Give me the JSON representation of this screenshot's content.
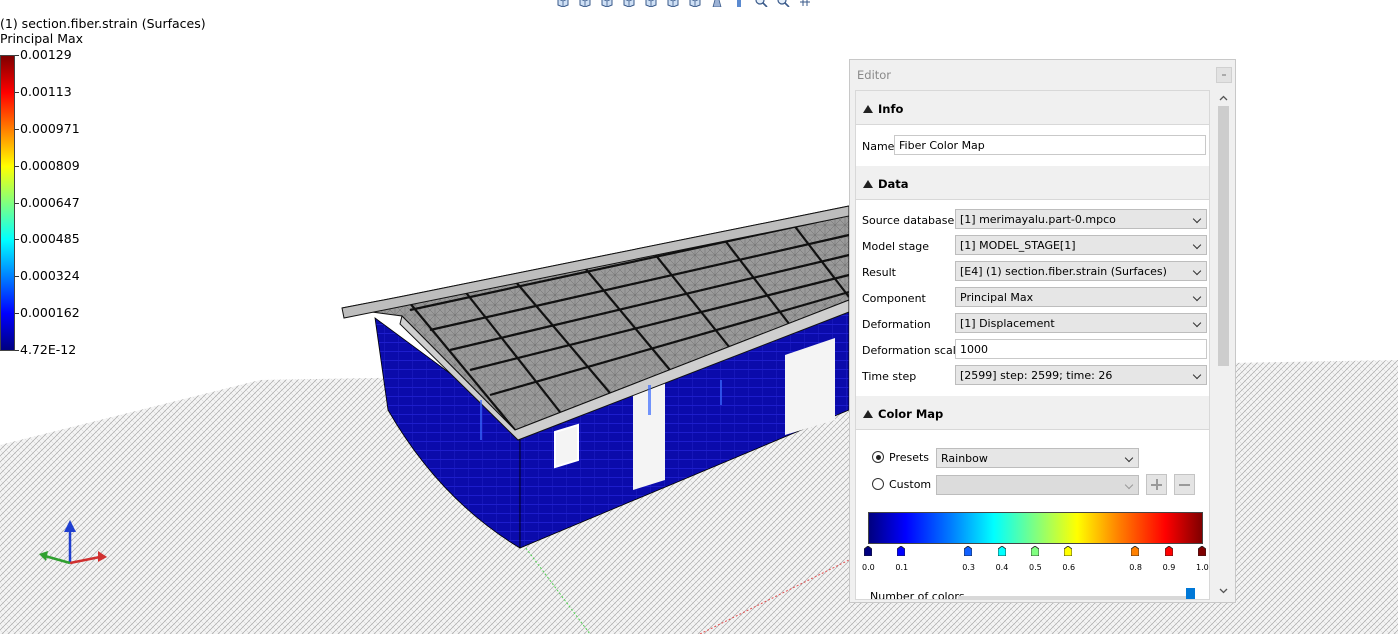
{
  "legend": {
    "title": "(1) section.fiber.strain (Surfaces)",
    "subtitle": "Principal Max",
    "labels": [
      "0.00129",
      "0.00113",
      "0.000971",
      "0.000809",
      "0.000647",
      "0.000485",
      "0.000324",
      "0.000162",
      "4.72E-12"
    ]
  },
  "toolbar": {
    "icons": [
      "view-iso-icon",
      "view-front-icon",
      "view-back-icon",
      "view-left-icon",
      "view-right-icon",
      "view-top-icon",
      "view-bottom-icon",
      "perspective-icon",
      "info-icon",
      "zoom-in-icon",
      "zoom-out-icon",
      "grid-icon"
    ]
  },
  "editor": {
    "title": "Editor",
    "sections": {
      "info": "Info",
      "data": "Data",
      "color_map": "Color Map"
    },
    "info": {
      "name_label": "Name",
      "name_value": "Fiber Color Map"
    },
    "data": {
      "source_database_label": "Source database",
      "source_database_value": "[1] merimayalu.part-0.mpco",
      "model_stage_label": "Model stage",
      "model_stage_value": "[1] MODEL_STAGE[1]",
      "result_label": "Result",
      "result_value": "[E4] (1) section.fiber.strain (Surfaces)",
      "component_label": "Component",
      "component_value": "Principal Max",
      "deformation_label": "Deformation",
      "deformation_value": "[1] Displacement",
      "deformation_scale_label": "Deformation scale",
      "deformation_scale_value": "1000",
      "time_step_label": "Time step",
      "time_step_value": "[2599] step: 2599; time: 26"
    },
    "color_map": {
      "presets_label": "Presets",
      "presets_value": "Rainbow",
      "custom_label": "Custom",
      "custom_value": "",
      "stops": [
        "0.0",
        "0.1",
        "0.3",
        "0.4",
        "0.5",
        "0.6",
        "0.8",
        "0.9",
        "1.0"
      ],
      "stop_colors": [
        "#00007f",
        "#0000ff",
        "#1060ff",
        "#00ffff",
        "#80ff80",
        "#ffff00",
        "#ff8000",
        "#ff0000",
        "#7f0000"
      ],
      "number_of_colors_label": "Number of colors"
    }
  },
  "colors": {
    "wall": "#0a0aa8",
    "roof": "#8a8a8a",
    "accent": "#0078d7"
  }
}
